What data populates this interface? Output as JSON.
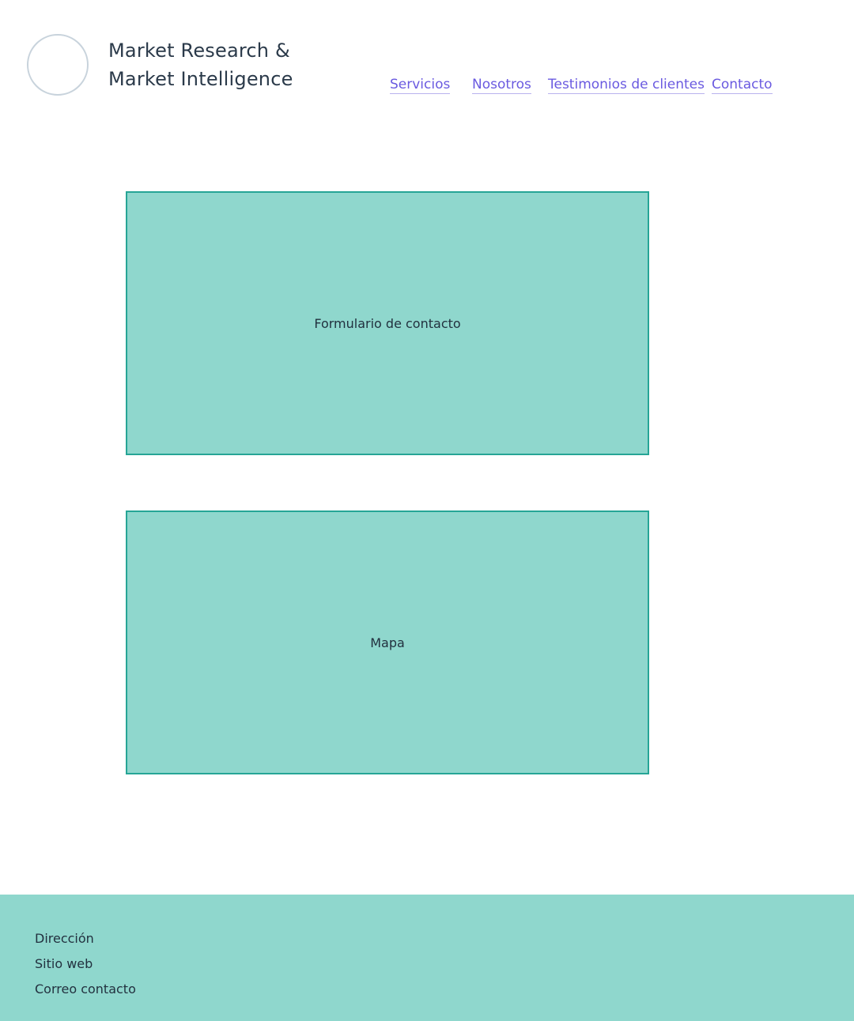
{
  "header": {
    "brand_line1": "Market Research &",
    "brand_line2": "Market Intelligence",
    "logo_icon": "logo-placeholder-circle"
  },
  "nav": {
    "items": [
      {
        "label": "Servicios"
      },
      {
        "label": "Nosotros"
      },
      {
        "label": "Testimonios de clientes"
      },
      {
        "label": "Contacto"
      }
    ]
  },
  "main": {
    "contact_form_label": "Formulario de contacto",
    "map_label": "Mapa"
  },
  "footer": {
    "items": [
      {
        "label": "Dirección"
      },
      {
        "label": "Sitio web"
      },
      {
        "label": "Correo contacto"
      }
    ]
  },
  "colors": {
    "accent": "#6a5ae0",
    "placeholder_fill": "#8fd7cd",
    "placeholder_border": "#26a596",
    "text": "#22313f"
  }
}
